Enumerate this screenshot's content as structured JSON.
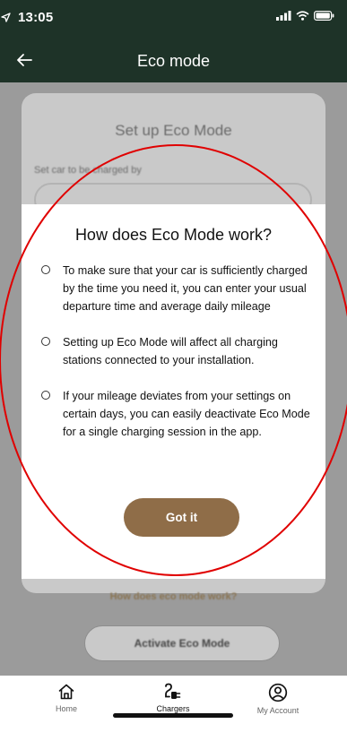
{
  "status_bar": {
    "time": "13:05"
  },
  "header": {
    "title": "Eco mode",
    "back_icon": "arrow-left-icon"
  },
  "background_screen": {
    "card_title": "Set up Eco Mode",
    "field_label": "Set car to be charged by",
    "help_link": "How does eco mode work?",
    "activate_button": "Activate Eco Mode"
  },
  "modal": {
    "title": "How does Eco Mode work?",
    "items": [
      "To make sure that your car is sufficiently charged by the time you need it, you can enter your usual departure time and average daily mileage",
      "Setting up Eco Mode will affect all charging stations connected to your installation.",
      "If your mileage deviates from your settings on certain days, you can easily deactivate Eco Mode for a single charging session in the app."
    ],
    "confirm_button": "Got it"
  },
  "tabbar": {
    "tabs": [
      {
        "label": "Home",
        "icon": "home-icon"
      },
      {
        "label": "Chargers",
        "icon": "charger-plug-icon"
      },
      {
        "label": "My Account",
        "icon": "account-icon"
      }
    ],
    "active": "Chargers"
  },
  "colors": {
    "header_bg": "#1e3328",
    "accent": "#8f6d48",
    "annotation": "#e00000"
  }
}
